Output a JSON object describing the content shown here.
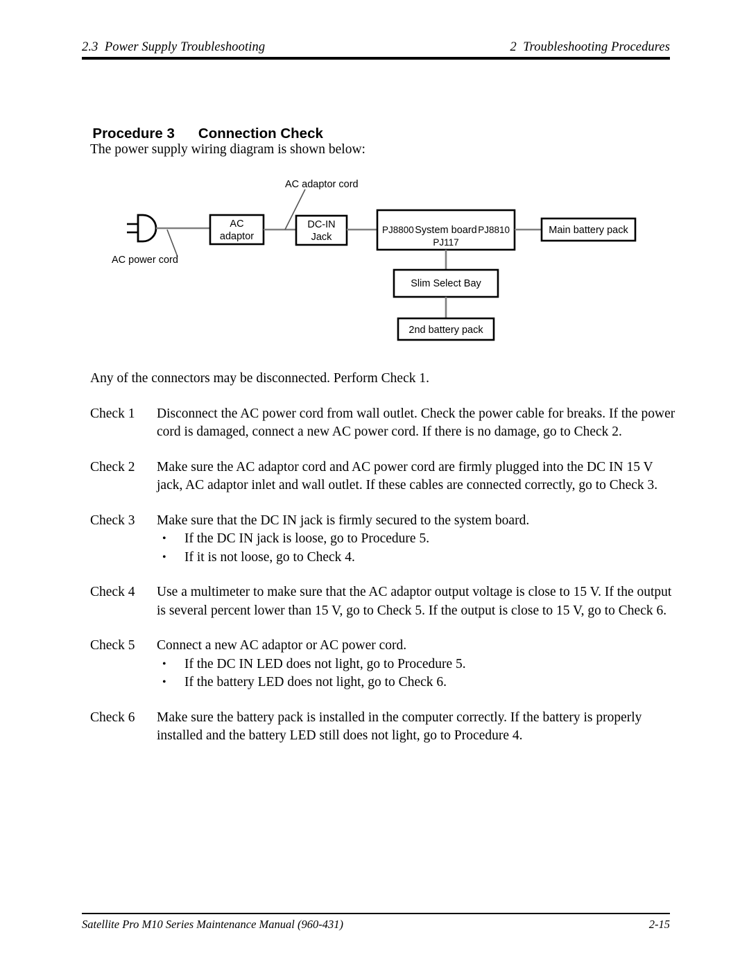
{
  "header": {
    "left": "2.3  Power Supply Troubleshooting",
    "right": "2  Troubleshooting Procedures"
  },
  "procedure": {
    "number_label": "Procedure 3",
    "title": "Connection Check"
  },
  "intro": "The power supply wiring diagram is shown below:",
  "diagram": {
    "title": "Power supply wiring diagram",
    "nodes": {
      "ac_plug": "AC plug",
      "ac_adaptor_line1": "AC",
      "ac_adaptor_line2": "adaptor",
      "dc_in_line1": "DC-IN",
      "dc_in_line2": "Jack",
      "system_board": "System board",
      "system_board_left_connector": "PJ8800",
      "system_board_right_connector": "PJ8810",
      "system_board_bottom_connector": "PJ117",
      "main_battery": "Main battery pack",
      "slim_select_bay": "Slim Select Bay",
      "second_battery": "2nd battery pack"
    },
    "callouts": {
      "ac_power_cord": "AC power cord",
      "ac_adaptor_cord": "AC adaptor cord"
    }
  },
  "body": {
    "lead_paragraph": "Any of the connectors may be disconnected.  Perform Check 1.",
    "checks": [
      {
        "label": "Check 1",
        "text": "Disconnect the AC power cord from wall outlet.  Check the power cable for breaks.  If the power cord is damaged, connect a new AC power cord.  If there is no damage, go to Check 2.",
        "bullets": []
      },
      {
        "label": "Check 2",
        "text": "Make sure the AC adaptor cord and AC power cord are firmly plugged into the DC IN 15 V jack, AC adaptor inlet and wall outlet.  If these cables are connected correctly, go to Check 3.",
        "bullets": []
      },
      {
        "label": "Check 3",
        "text": "Make sure that the DC IN jack is firmly secured to the system board.",
        "bullets": [
          "If the DC IN jack is loose, go to Procedure 5.",
          "If it is not loose, go to Check 4."
        ]
      },
      {
        "label": "Check 4",
        "text": "Use a multimeter to make sure that the AC adaptor output voltage is close to 15 V.  If the output is several percent lower than 15 V, go to Check 5.  If the output is close to 15 V, go to Check 6.",
        "bullets": []
      },
      {
        "label": "Check 5",
        "text": "Connect a new AC adaptor or AC power cord.",
        "bullets": [
          "If the DC IN LED does not light, go to Procedure 5.",
          "If the battery LED does not light, go to Check 6."
        ]
      },
      {
        "label": "Check 6",
        "text": "Make sure the battery pack is installed in the computer correctly.  If the battery is properly installed and the battery LED still does not light, go to Procedure 4.",
        "bullets": []
      }
    ],
    "bullet_glyph": "•"
  },
  "footer": {
    "left": "Satellite Pro M10 Series Maintenance Manual (960-431)",
    "right": "2-15"
  },
  "colors": {
    "text": "#000000",
    "page_background": "#ffffff",
    "rule": "#000000",
    "connector_line": "#808080"
  }
}
